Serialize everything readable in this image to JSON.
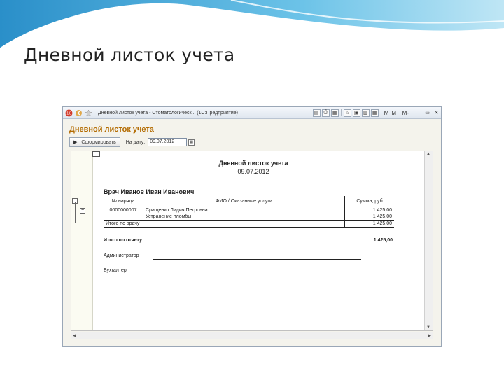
{
  "slide": {
    "title": "Дневной листок учета"
  },
  "window": {
    "title": "Дневной листок учета - Стоматологическ...  (1С:Предприятие)",
    "toolbar_m": "M",
    "toolbar_mplus": "M+",
    "toolbar_mminus": "M-",
    "app_icon": "1c-logo-icon",
    "colors": {
      "accent_orange": "#b36b00",
      "frame_blue": "#9aa7b7",
      "swoosh": "#3fa9d8"
    }
  },
  "form": {
    "heading": "Дневной листок учета",
    "generate_button": "Сформировать",
    "date_label": "На дату:",
    "date_value": "09.07.2012"
  },
  "report": {
    "title": "Дневной листок учета",
    "date": "09.07.2012",
    "doctor": "Врач Иванов Иван Иванович",
    "columns": [
      "№ наряда",
      "ФИО / Оказанные услуги",
      "Сумма, руб"
    ],
    "rows": [
      {
        "order": "0000000007",
        "name": "Сращенко Лидия Петровна",
        "sum": "1 425,00"
      },
      {
        "order": "",
        "name": "Устранение пломбы",
        "sum": "1 425,00"
      }
    ],
    "doctor_total_label": "Итого по врачу",
    "doctor_total_value": "1 425,00",
    "report_total_label": "Итого по отчету",
    "report_total_value": "1 425,00",
    "signatures": [
      {
        "label": "Администратор"
      },
      {
        "label": "Бухгалтер"
      }
    ]
  }
}
